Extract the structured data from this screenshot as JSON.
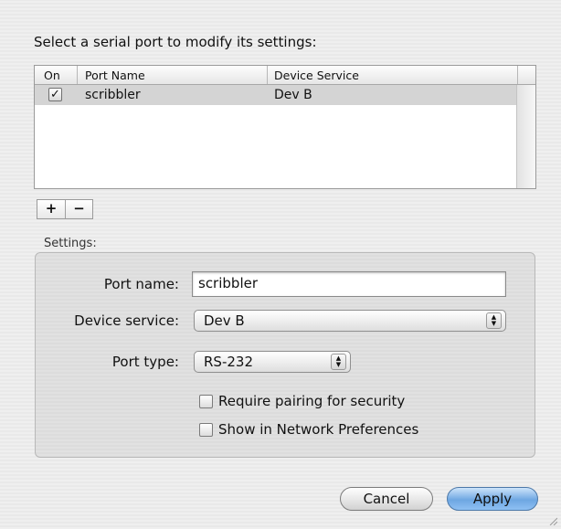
{
  "prompt": "Select a serial port to modify its settings:",
  "table": {
    "columns": [
      "On",
      "Port Name",
      "Device Service"
    ],
    "rows": [
      {
        "on": true,
        "on_mark": "✓",
        "port_name": "scribbler",
        "device_service": "Dev B"
      }
    ]
  },
  "toolbar": {
    "add_label": "+",
    "remove_label": "−"
  },
  "settings": {
    "section_label": "Settings:",
    "port_name_label": "Port name:",
    "port_name_value": "scribbler",
    "device_service_label": "Device service:",
    "device_service_value": "Dev B",
    "port_type_label": "Port type:",
    "port_type_value": "RS-232",
    "require_pairing_label": "Require pairing for security",
    "require_pairing_checked": false,
    "show_in_network_label": "Show in Network Preferences",
    "show_in_network_checked": false
  },
  "buttons": {
    "cancel": "Cancel",
    "apply": "Apply"
  },
  "colors": {
    "default_button": "#6ea7e2",
    "selected_row": "#d4d4d4"
  }
}
